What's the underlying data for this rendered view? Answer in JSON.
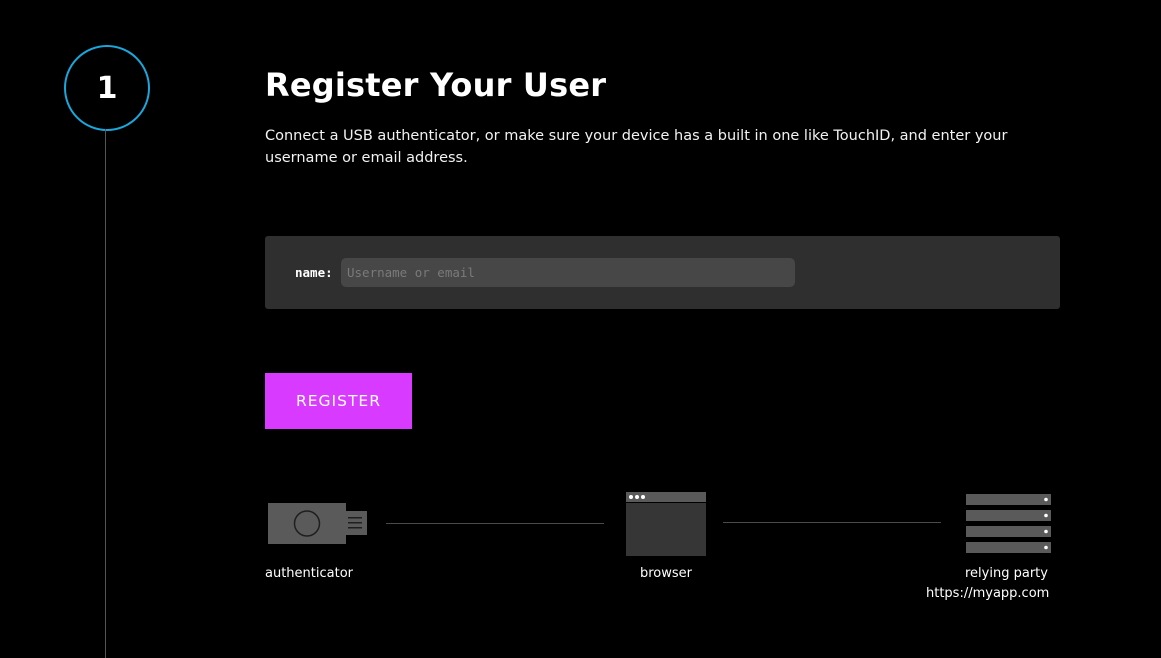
{
  "step": {
    "number": "1"
  },
  "header": {
    "title": "Register Your User",
    "description": "Connect a USB authenticator, or make sure your device has a built in one like TouchID, and enter your username or email address."
  },
  "form": {
    "name_label": "name:",
    "name_placeholder": "Username or email",
    "name_value": ""
  },
  "actions": {
    "register_label": "REGISTER"
  },
  "diagram": {
    "authenticator_label": "authenticator",
    "browser_label": "browser",
    "relying_party_label": "relying party",
    "relying_party_url": "https://myapp.com",
    "icons": {
      "authenticator": "usb-key-icon",
      "browser": "browser-window-icon",
      "relying_party": "server-rack-icon"
    }
  },
  "colors": {
    "background": "#000000",
    "step_ring": "#1aa7dc",
    "panel": "#2f2f2f",
    "input": "#474747",
    "accent_button": "#d93aff",
    "diagram_gray": "#5a5a5a"
  }
}
